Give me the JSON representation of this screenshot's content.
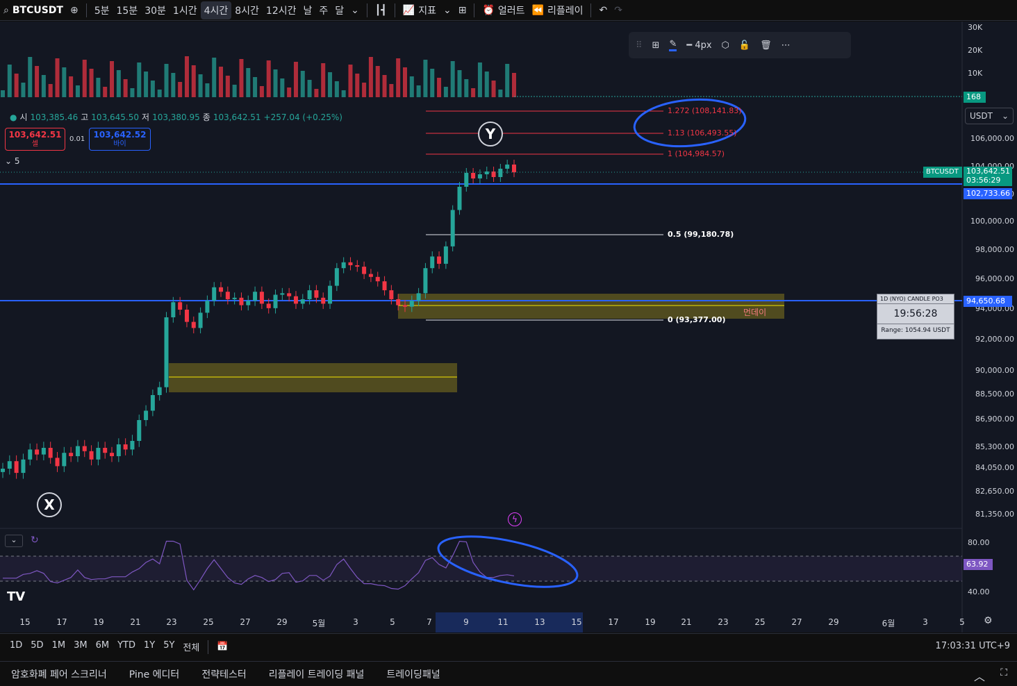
{
  "toolbar": {
    "symbol": "BTCUSDT",
    "intervals": [
      "5분",
      "15분",
      "30분",
      "1시간",
      "4시간",
      "8시간",
      "12시간",
      "날",
      "주",
      "달"
    ],
    "active_interval": "4시간",
    "indicators_label": "지표",
    "alert_label": "얼러트",
    "replay_label": "리플레이"
  },
  "ohlc": {
    "open_label": "시",
    "open": "103,385.46",
    "high_label": "고",
    "high": "103,645.50",
    "low_label": "저",
    "low": "103,380.95",
    "close_label": "종",
    "close": "103,642.51",
    "change": "+257.04 (+0.25%)"
  },
  "trade": {
    "sell_price": "103,642.51",
    "sell_label": "셀",
    "spread": "0.01",
    "buy_price": "103,642.52",
    "buy_label": "바이",
    "collapse_count": "5"
  },
  "drawing_toolbar": {
    "width_label": "4px"
  },
  "currency_select": "USDT",
  "price_tags": {
    "symbol": "BTCUSDT",
    "last_price": "103,642.51",
    "countdown": "03:56:29",
    "line1": "102,733.66",
    "line2": "94,650.68",
    "volume": "168",
    "rsi": "63.92"
  },
  "timer_box": {
    "title": "1D (NYO) CANDLE PO3",
    "time": "19:56:28",
    "range": "Range: 1054.94 USDT"
  },
  "zone_label": "먼데이",
  "wave_labels": {
    "x": "X",
    "y": "Y"
  },
  "bottom": {
    "ranges": [
      "1D",
      "5D",
      "1M",
      "3M",
      "6M",
      "YTD",
      "1Y",
      "5Y",
      "전체"
    ],
    "clock": "17:03:31 UTC+9"
  },
  "panels": [
    "암호화폐 페어 스크리너",
    "Pine 에디터",
    "전략테스터",
    "리플레이 트레이딩 패널",
    "트레이딩패널"
  ],
  "chart_data": {
    "type": "candlestick",
    "x_ticks": [
      "15",
      "17",
      "19",
      "21",
      "23",
      "25",
      "27",
      "29",
      "5월",
      "3",
      "5",
      "7",
      "9",
      "11",
      "13",
      "15",
      "17",
      "19",
      "21",
      "23",
      "25",
      "27",
      "29",
      "6월",
      "3",
      "5"
    ],
    "y_ticks": [
      "106,000.00",
      "104,000.00",
      "102,000.00",
      "100,000.00",
      "98,000.00",
      "96,000.00",
      "94,000.00",
      "92,000.00",
      "90,000.00",
      "88,500.00",
      "86,900.00",
      "85,300.00",
      "84,050.00",
      "82,650.00",
      "81,350.00"
    ],
    "volume_ticks": [
      "30K",
      "20K",
      "10K"
    ],
    "rsi_ticks": [
      "80.00",
      "60.00",
      "40.00"
    ],
    "fib_levels": [
      {
        "label": "1.272 (108,141.83)",
        "color": "#f23645"
      },
      {
        "label": "1.13 (106,493.55)",
        "color": "#f23645"
      },
      {
        "label": "1 (104,984.57)",
        "color": "#f23645"
      },
      {
        "label": "0.5 (99,180.78)",
        "color": "#ffffff"
      },
      {
        "label": "0 (93,377.00)",
        "color": "#ffffff"
      }
    ],
    "horizontal_lines": [
      102733.66,
      94650.68
    ],
    "close_series": [
      84050,
      84500,
      83800,
      84600,
      85200,
      84900,
      85300,
      84700,
      84200,
      85000,
      84800,
      85400,
      85100,
      84600,
      85300,
      85000,
      84800,
      85500,
      85200,
      85700,
      86900,
      87500,
      88500,
      89000,
      93500,
      94500,
      94000,
      93200,
      92800,
      93800,
      94600,
      95500,
      95200,
      94700,
      94800,
      94300,
      94600,
      95200,
      94400,
      94100,
      95000,
      95100,
      94900,
      94400,
      94700,
      95300,
      94800,
      94400,
      95600,
      96800,
      97200,
      97000,
      96900,
      96400,
      96200,
      95900,
      95300,
      94700,
      94300,
      94200,
      94600,
      95100,
      96800,
      97600,
      97100,
      98300,
      100900,
      102600,
      103600,
      103200,
      103500,
      103700,
      103300,
      103900,
      104200,
      103642
    ]
  }
}
